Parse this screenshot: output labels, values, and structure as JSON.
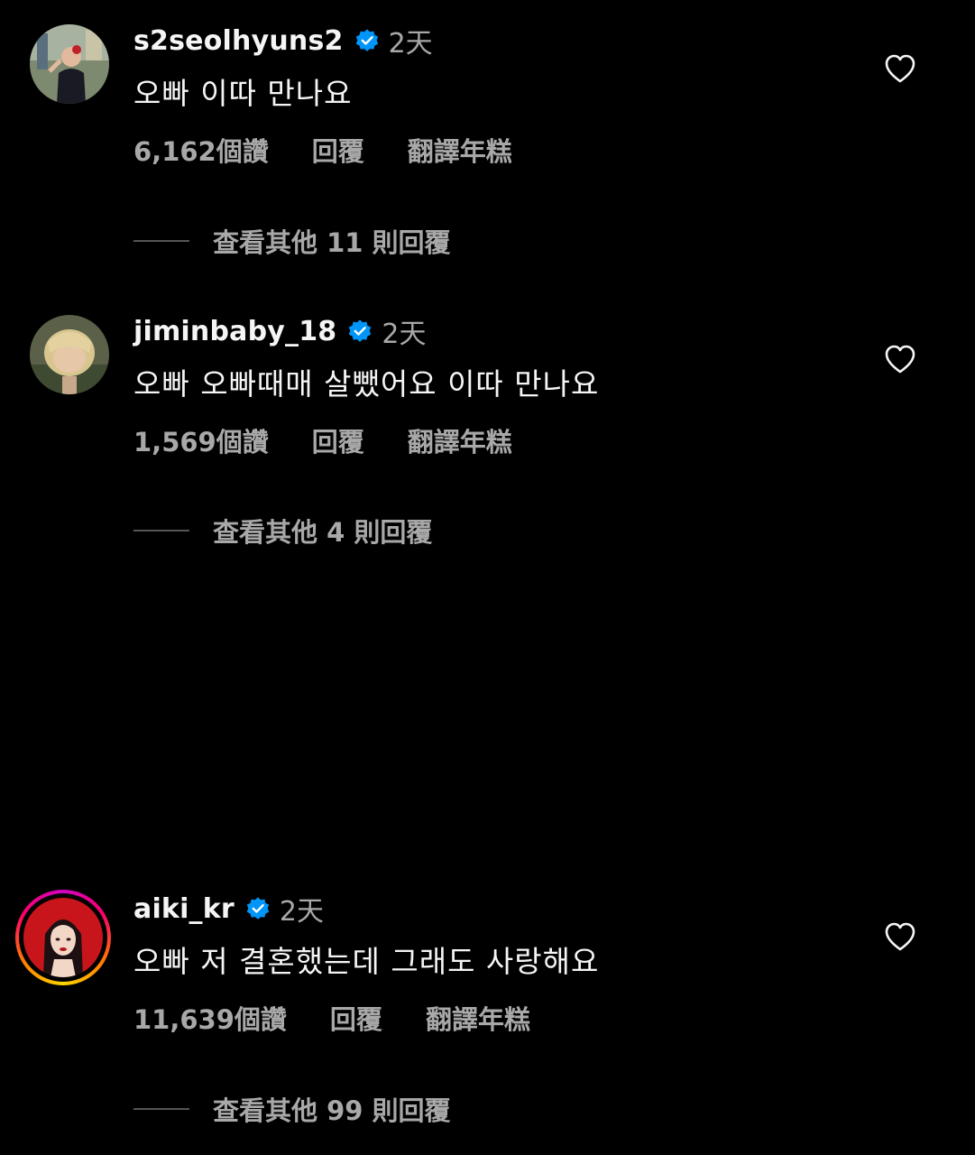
{
  "comments": [
    {
      "username": "s2seolhyuns2",
      "time": "2天",
      "text": "오빠 이따 만나요",
      "likes": "6,162個讚",
      "reply": "回覆",
      "translate": "翻譯年糕",
      "view_replies": "查看其他 11 則回覆",
      "verified": true
    },
    {
      "username": "jiminbaby_18",
      "time": "2天",
      "text": "오빠 오빠때매 살뺐어요 이따 만나요",
      "likes": "1,569個讚",
      "reply": "回覆",
      "translate": "翻譯年糕",
      "view_replies": "查看其他 4 則回覆",
      "verified": true
    },
    {
      "username": "aiki_kr",
      "time": "2天",
      "text": "오빠 저 결혼했는데 그래도 사랑해요",
      "likes": "11,639個讚",
      "reply": "回覆",
      "translate": "翻譯年糕",
      "view_replies": "查看其他 99 則回覆",
      "verified": true,
      "has_story_ring": true
    }
  ],
  "icons": {
    "verified": "verified-badge-icon",
    "like": "heart-outline-icon"
  },
  "colors": {
    "background": "#000000",
    "primary_text": "#f5f5f5",
    "secondary_text": "#a8a8a8",
    "verified_blue": "#0095f6"
  }
}
